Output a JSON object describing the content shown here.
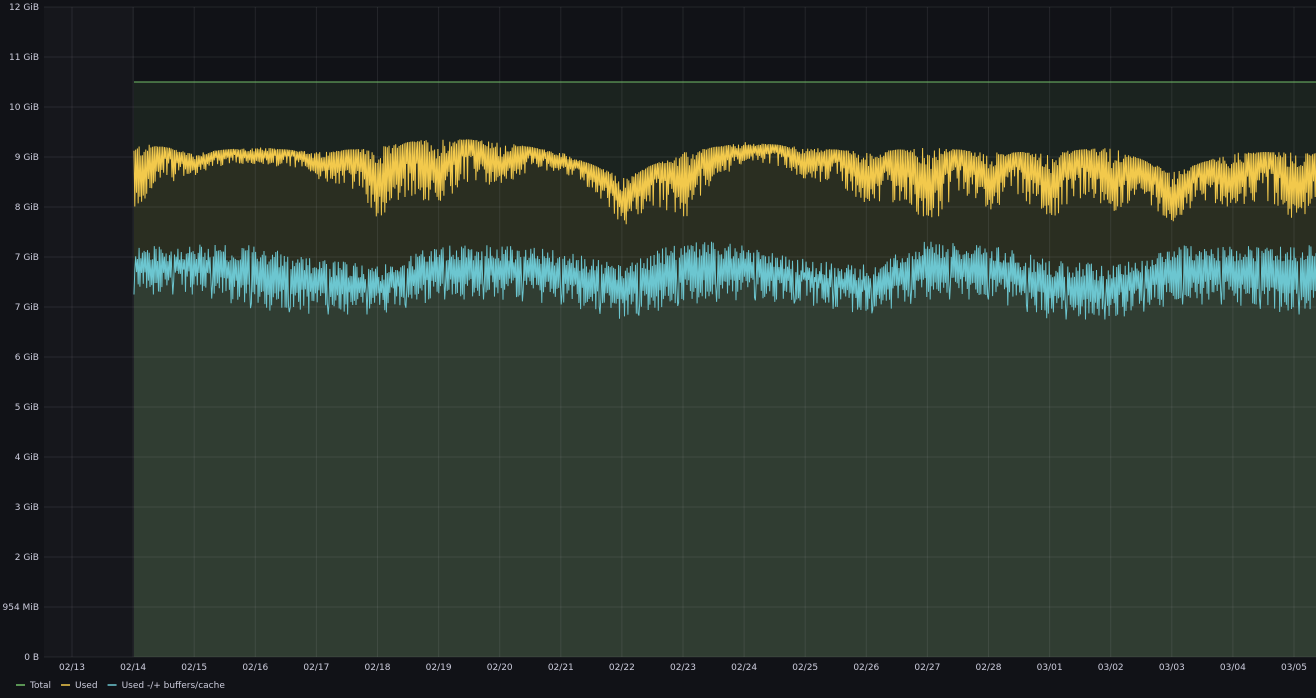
{
  "chart_data": {
    "type": "area",
    "title": "",
    "xlabel": "",
    "ylabel": "",
    "y_ticks": [
      "0 B",
      "954 MiB",
      "2 GiB",
      "3 GiB",
      "4 GiB",
      "5 GiB",
      "6 GiB",
      "7 GiB",
      "7 GiB",
      "8 GiB",
      "9 GiB",
      "10 GiB",
      "11 GiB",
      "12 GiB"
    ],
    "x_ticks": [
      "02/13",
      "02/14",
      "02/15",
      "02/16",
      "02/17",
      "02/18",
      "02/19",
      "02/20",
      "02/21",
      "02/22",
      "02/23",
      "02/24",
      "02/25",
      "02/26",
      "02/27",
      "02/28",
      "03/01",
      "03/02",
      "03/03",
      "03/04",
      "03/05"
    ],
    "ylim": [
      0,
      13
    ],
    "grid": true,
    "legend_position": "bottom-left",
    "series": [
      {
        "name": "Total",
        "color": "#73bf69",
        "daily_values": [
          11.5,
          11.5,
          11.5,
          11.5,
          11.5,
          11.5,
          11.5,
          11.5,
          11.5,
          11.5,
          11.5,
          11.5,
          11.5,
          11.5,
          11.5,
          11.5,
          11.5,
          11.5,
          11.5,
          11.5
        ]
      },
      {
        "name": "Used",
        "color": "#f2c94c",
        "daily_values": [
          10.3,
          10.1,
          10.2,
          10.1,
          10.2,
          10.4,
          10.3,
          10.1,
          9.6,
          10.1,
          10.3,
          10.2,
          10.1,
          10.2,
          10.1,
          10.1,
          10.2,
          9.7,
          10.1,
          10.1
        ],
        "daily_min": [
          8.4,
          9.5,
          9.7,
          9.4,
          8.3,
          8.5,
          9.1,
          9.6,
          8.3,
          8.3,
          9.8,
          9.3,
          8.6,
          8.1,
          8.6,
          8.3,
          8.5,
          8.4,
          8.6,
          8.3
        ]
      },
      {
        "name": "Used -/+ buffers/cache",
        "color": "#6cc6d0",
        "daily_values": [
          7.8,
          7.8,
          7.8,
          7.5,
          7.4,
          7.8,
          7.8,
          7.7,
          7.4,
          7.9,
          7.8,
          7.5,
          7.4,
          7.9,
          7.8,
          7.5,
          7.4,
          7.8,
          7.8,
          7.8
        ],
        "daily_min": [
          7.3,
          7.3,
          7.0,
          6.9,
          6.9,
          7.2,
          7.2,
          7.1,
          6.8,
          7.1,
          7.2,
          7.1,
          6.9,
          7.2,
          7.2,
          6.8,
          6.8,
          7.1,
          7.1,
          6.9
        ]
      }
    ]
  }
}
